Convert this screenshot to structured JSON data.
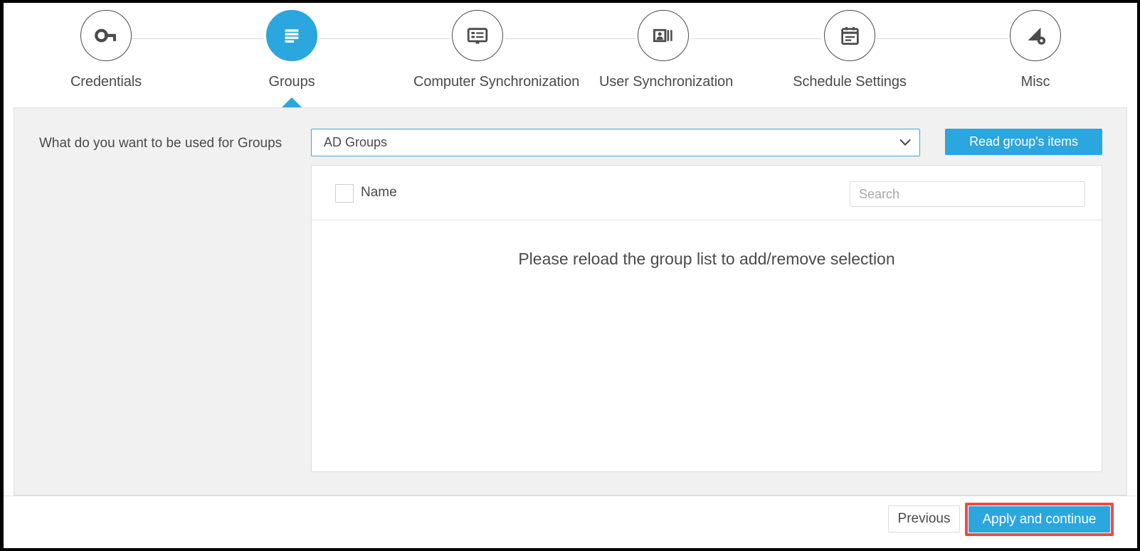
{
  "colors": {
    "accent": "#2ba6de",
    "highlight_border": "#ef4a47",
    "panel_bg": "#f1f1f1",
    "text": "#4a4a4a",
    "border": "#dcdcdc"
  },
  "wizard": {
    "steps": [
      {
        "label": "Credentials",
        "icon": "key-icon",
        "active": false
      },
      {
        "label": "Groups",
        "icon": "list-lines-icon",
        "active": true
      },
      {
        "label": "Computer Synchronization",
        "icon": "monitor-list-icon",
        "active": false
      },
      {
        "label": "User Synchronization",
        "icon": "user-card-icon",
        "active": false
      },
      {
        "label": "Schedule Settings",
        "icon": "calendar-icon",
        "active": false
      },
      {
        "label": "Misc",
        "icon": "tools-gear-icon",
        "active": false
      }
    ]
  },
  "form": {
    "question_label": "What do you want to be used for Groups",
    "group_source": {
      "selected": "AD Groups",
      "options": [
        "AD Groups"
      ]
    },
    "read_items_button": "Read group's items"
  },
  "list": {
    "column_header_name": "Name",
    "search_placeholder": "Search",
    "search_value": "",
    "select_all_checked": false,
    "empty_message": "Please reload the group list to add/remove selection",
    "rows": []
  },
  "footer": {
    "previous_button": "Previous",
    "apply_button": "Apply and continue"
  }
}
